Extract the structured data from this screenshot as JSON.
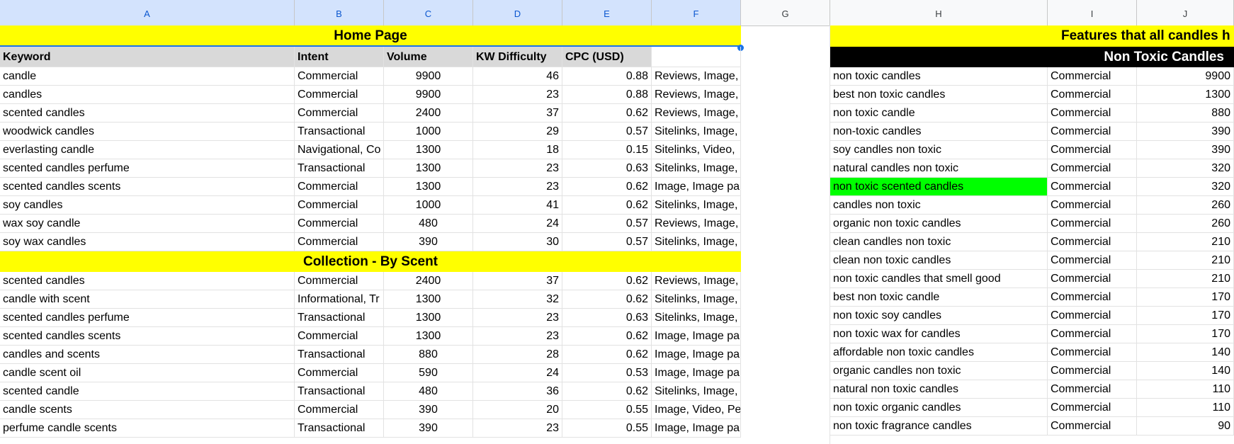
{
  "columns": [
    "A",
    "B",
    "C",
    "D",
    "E",
    "F",
    "G",
    "H",
    "I",
    "J"
  ],
  "home_title": "Home Page",
  "home_headers": [
    "Keyword",
    "Intent",
    "Volume",
    "KW Difficulty",
    "CPC (USD)"
  ],
  "home_rows": [
    [
      "candle",
      "Commercial",
      "9900",
      "46",
      "0.88",
      "Reviews, Image,"
    ],
    [
      "candles",
      "Commercial",
      "9900",
      "23",
      "0.88",
      "Reviews, Image,"
    ],
    [
      "scented candles",
      "Commercial",
      "2400",
      "37",
      "0.62",
      "Reviews, Image,"
    ],
    [
      "woodwick candles",
      "Transactional",
      "1000",
      "29",
      "0.57",
      "Sitelinks, Image,"
    ],
    [
      "everlasting candle",
      "Navigational, Co",
      "1300",
      "18",
      "0.15",
      "Sitelinks, Video,"
    ],
    [
      "scented candles perfume",
      "Transactional",
      "1300",
      "23",
      "0.63",
      "Sitelinks, Image,"
    ],
    [
      "scented candles scents",
      "Commercial",
      "1300",
      "23",
      "0.62",
      "Image, Image pa"
    ],
    [
      "soy candles",
      "Commercial",
      "1000",
      "41",
      "0.62",
      "Sitelinks, Image,"
    ],
    [
      "wax soy candle",
      "Commercial",
      "480",
      "24",
      "0.57",
      "Reviews, Image,"
    ],
    [
      "soy wax candles",
      "Commercial",
      "390",
      "30",
      "0.57",
      "Sitelinks, Image,"
    ]
  ],
  "collection_title": "Collection - By Scent",
  "collection_rows": [
    [
      "scented candles",
      "Commercial",
      "2400",
      "37",
      "0.62",
      "Reviews, Image,"
    ],
    [
      "candle with scent",
      "Informational, Tr",
      "1300",
      "32",
      "0.62",
      "Sitelinks, Image,"
    ],
    [
      "scented candles perfume",
      "Transactional",
      "1300",
      "23",
      "0.63",
      "Sitelinks, Image,"
    ],
    [
      "scented candles scents",
      "Commercial",
      "1300",
      "23",
      "0.62",
      "Image, Image pa"
    ],
    [
      "candles and scents",
      "Transactional",
      "880",
      "28",
      "0.62",
      "Image, Image pa"
    ],
    [
      "candle scent oil",
      "Commercial",
      "590",
      "24",
      "0.53",
      "Image, Image pa"
    ],
    [
      "scented candle",
      "Transactional",
      "480",
      "36",
      "0.62",
      "Sitelinks, Image,"
    ],
    [
      "candle scents",
      "Commercial",
      "390",
      "20",
      "0.55",
      "Image, Video, Pe"
    ],
    [
      "perfume candle scents",
      "Transactional",
      "390",
      "23",
      "0.55",
      "Image, Image pa"
    ]
  ],
  "features_title": "Features that all candles h",
  "nontoxic_title": "Non Toxic Candles",
  "nontoxic_rows": [
    [
      "non toxic candles",
      "Commercial",
      "9900"
    ],
    [
      "best non toxic candles",
      "Commercial",
      "1300"
    ],
    [
      "non toxic candle",
      "Commercial",
      "880"
    ],
    [
      "non-toxic candles",
      "Commercial",
      "390"
    ],
    [
      "soy candles non toxic",
      "Commercial",
      "390"
    ],
    [
      "natural candles non toxic",
      "Commercial",
      "320"
    ],
    [
      "non toxic scented candles",
      "Commercial",
      "320"
    ],
    [
      "candles non toxic",
      "Commercial",
      "260"
    ],
    [
      "organic non toxic candles",
      "Commercial",
      "260"
    ],
    [
      "clean candles non toxic",
      "Commercial",
      "210"
    ],
    [
      "clean non toxic candles",
      "Commercial",
      "210"
    ],
    [
      "non toxic candles that smell good",
      "Commercial",
      "210"
    ],
    [
      "best non toxic candle",
      "Commercial",
      "170"
    ],
    [
      "non toxic soy candles",
      "Commercial",
      "170"
    ],
    [
      "non toxic wax for candles",
      "Commercial",
      "170"
    ],
    [
      "affordable non toxic candles",
      "Commercial",
      "140"
    ],
    [
      "organic candles non toxic",
      "Commercial",
      "140"
    ],
    [
      "natural non toxic candles",
      "Commercial",
      "110"
    ],
    [
      "non toxic organic candles",
      "Commercial",
      "110"
    ],
    [
      "non toxic fragrance candles",
      "Commercial",
      "90"
    ]
  ],
  "highlight_row_text": "non toxic scented candles",
  "colors": {
    "yellow": "#ffff00",
    "green": "#00ff00",
    "selected_header": "#d3e3fd",
    "selection_border": "#1a73e8"
  }
}
